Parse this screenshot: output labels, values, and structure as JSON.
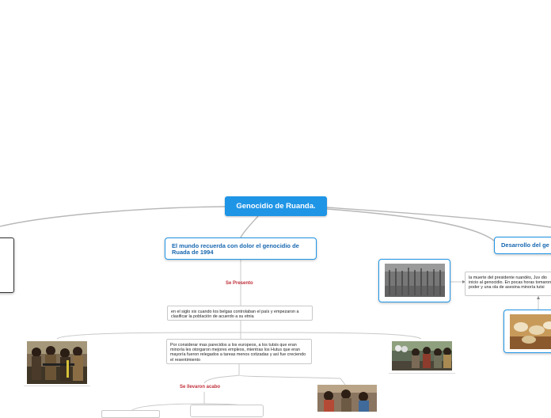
{
  "map": {
    "root": {
      "title": "Genocidio de Ruanda."
    },
    "branch_left": {
      "title": "El mundo recuerda con dolor el genocidio de Ruada de 1994",
      "link_label_1": "Se Presento",
      "text_1": "en el siglo xix  cuando los belgas controlaban el país y empezaron a clasificar la población de acuerdo a su etnia",
      "text_2": "Por considerar mas parecidos a los europeos, a los tutsis que eran minoría les otorgaron mejores empleos, mientras los Hutus que eran mayoría fueron relegados a tareas menos cotizadas y así fue creciendo el resentimiento",
      "link_label_2": "Se llevaron acabo"
    },
    "branch_right": {
      "title": "Desarrollo del ge",
      "text_1": "la muerte del presidente ruandés, Juv dio inicio al genocidio. En pocas horas tomaron el poder y una ola de asesina minoría tutsi"
    }
  },
  "colors": {
    "accent": "#1f95e6",
    "link_label": "#c0303a",
    "connector": "#b8b8b8"
  }
}
